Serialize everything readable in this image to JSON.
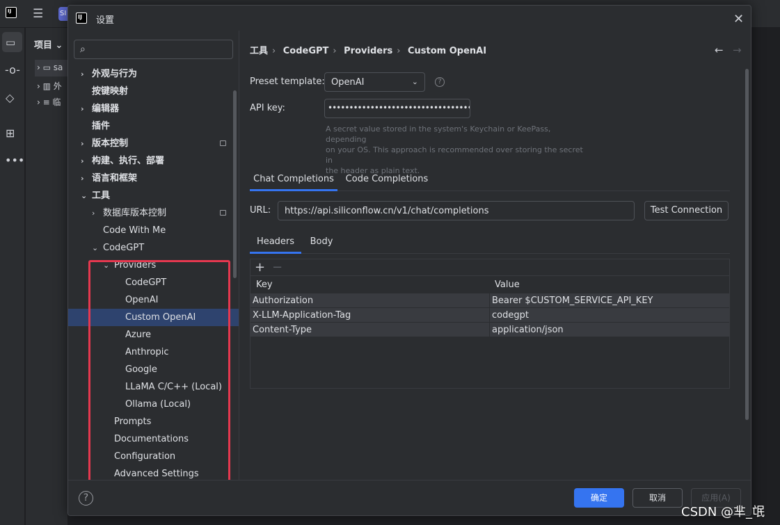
{
  "ide": {
    "project_label": "项目",
    "tree_fragments": [
      "sa",
      "外",
      "临"
    ],
    "project_badge": "SI"
  },
  "dialog": {
    "title": "设置",
    "search_placeholder": ""
  },
  "tree": {
    "items": [
      {
        "label": "外观与行为",
        "chevron": "›",
        "bold": true
      },
      {
        "label": "按键映射",
        "chevron": "",
        "bold": true
      },
      {
        "label": "编辑器",
        "chevron": "›",
        "bold": true
      },
      {
        "label": "插件",
        "chevron": "",
        "bold": true
      },
      {
        "label": "版本控制",
        "chevron": "›",
        "bold": true
      },
      {
        "label": "构建、执行、部署",
        "chevron": "›",
        "bold": true
      },
      {
        "label": "语言和框架",
        "chevron": "›",
        "bold": true
      },
      {
        "label": "工具",
        "chevron": "⌄",
        "bold": true
      },
      {
        "label": "数据库版本控制",
        "chevron": "›",
        "bold": false
      },
      {
        "label": "Code With Me",
        "chevron": "",
        "bold": false
      },
      {
        "label": "CodeGPT",
        "chevron": "⌄",
        "bold": false
      },
      {
        "label": "Providers",
        "chevron": "⌄",
        "bold": false
      },
      {
        "label": "CodeGPT",
        "chevron": "",
        "bold": false
      },
      {
        "label": "OpenAI",
        "chevron": "",
        "bold": false
      },
      {
        "label": "Custom OpenAI",
        "chevron": "",
        "bold": false
      },
      {
        "label": "Azure",
        "chevron": "",
        "bold": false
      },
      {
        "label": "Anthropic",
        "chevron": "",
        "bold": false
      },
      {
        "label": "Google",
        "chevron": "",
        "bold": false
      },
      {
        "label": "LLaMA C/C++ (Local)",
        "chevron": "",
        "bold": false
      },
      {
        "label": "Ollama (Local)",
        "chevron": "",
        "bold": false
      },
      {
        "label": "Prompts",
        "chevron": "",
        "bold": false
      },
      {
        "label": "Documentations",
        "chevron": "",
        "bold": false
      },
      {
        "label": "Configuration",
        "chevron": "",
        "bold": false
      },
      {
        "label": "Advanced Settings",
        "chevron": "",
        "bold": false
      }
    ]
  },
  "breadcrumb": [
    "工具",
    "CodeGPT",
    "Providers",
    "Custom OpenAI"
  ],
  "form": {
    "preset_label": "Preset template:",
    "preset_value": "OpenAI",
    "apikey_label": "API key:",
    "apikey_value": "••••••••••••••••••••••••••••••••••••••••",
    "hint_line1": "A secret value stored in the system's Keychain or KeePass, depending",
    "hint_line2": "on your OS. This approach is recommended over storing the secret in",
    "hint_line3": "the header as plain text.",
    "tab_chat": "Chat Completions",
    "tab_code": "Code Completions",
    "url_label": "URL:",
    "url_value": "https://api.siliconflow.cn/v1/chat/completions",
    "test_button": "Test Connection",
    "subtab_headers": "Headers",
    "subtab_body": "Body"
  },
  "headers_table": {
    "columns": [
      "Key",
      "Value"
    ],
    "rows": [
      [
        "Authorization",
        "Bearer $CUSTOM_SERVICE_API_KEY"
      ],
      [
        "X-LLM-Application-Tag",
        "codegpt"
      ],
      [
        "Content-Type",
        "application/json"
      ]
    ]
  },
  "footer": {
    "ok": "确定",
    "cancel": "取消",
    "apply": "应用(A)"
  },
  "watermark": "CSDN @芈_氓",
  "colors": {
    "accent": "#3574f0",
    "highlight_box": "#e5384f",
    "selection": "#2e436e"
  }
}
